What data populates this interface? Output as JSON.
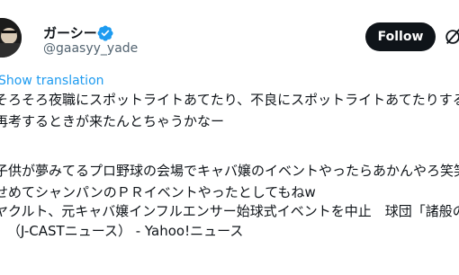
{
  "author": {
    "name": "ガーシー",
    "handle": "@gaasyy_yade",
    "verified": true
  },
  "actions": {
    "follow_label": "Follow"
  },
  "translation": {
    "label": "Show translation"
  },
  "tweet": {
    "lines": [
      "そろそろ夜職にスポットライトあてたり、不良にスポットライトあてたりする",
      "再考するときが来たんとちゃうかなー",
      "",
      "子供が夢みてるプロ野球の会場でキャバ嬢のイベントやったらあかんやろ笑笑",
      "せめてシャンパンのＰＲイベントやったとしてもねw",
      "",
      "ヤクルト、元キャバ嬢インフルエンサー始球式イベントを中止　球団「諸般の事",
      "（J-CASTニュース） - Yahoo!ニュース"
    ]
  },
  "colors": {
    "text": "#0f1419",
    "secondary": "#536471",
    "link": "#1d9bf0",
    "follow_bg": "#0f1419",
    "verified_badge": "#1d9bf0"
  },
  "icons": {
    "verified": "verified-badge-icon",
    "grok": "grok-icon"
  }
}
